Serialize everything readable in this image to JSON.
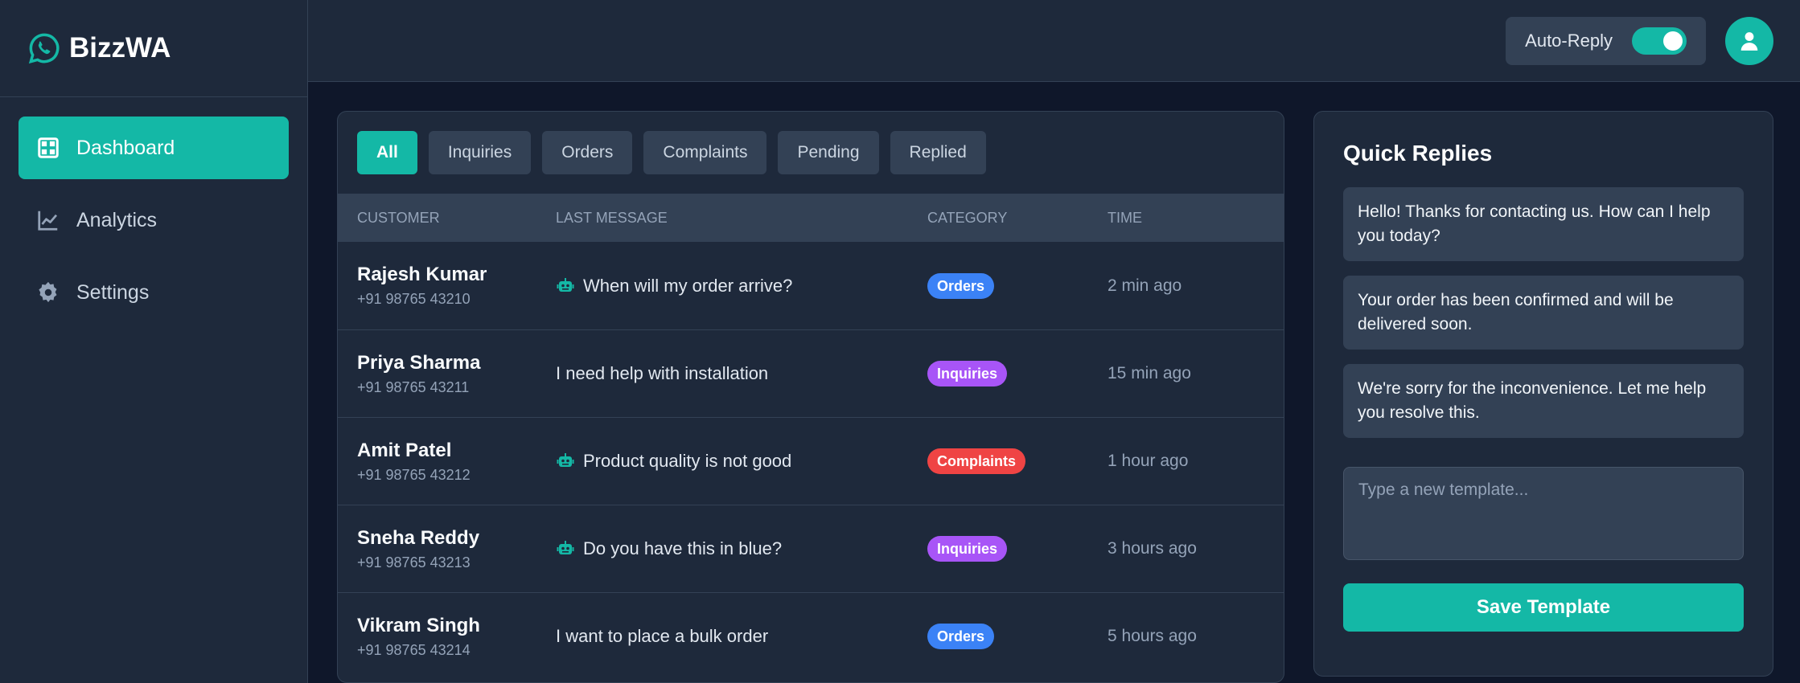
{
  "brand": {
    "name": "BizzWA"
  },
  "colors": {
    "accent": "#14b8a6",
    "orders": "#3b82f6",
    "inquiries": "#a855f7",
    "complaints": "#ef4444"
  },
  "sidebar": {
    "items": [
      {
        "label": "Dashboard",
        "icon": "dashboard-icon",
        "active": true
      },
      {
        "label": "Analytics",
        "icon": "chart-line-icon",
        "active": false
      },
      {
        "label": "Settings",
        "icon": "gear-icon",
        "active": false
      }
    ]
  },
  "topbar": {
    "auto_reply_label": "Auto-Reply",
    "auto_reply_on": true
  },
  "filters": [
    "All",
    "Inquiries",
    "Orders",
    "Complaints",
    "Pending",
    "Replied"
  ],
  "table": {
    "headers": [
      "CUSTOMER",
      "LAST MESSAGE",
      "CATEGORY",
      "TIME"
    ],
    "rows": [
      {
        "name": "Rajesh Kumar",
        "phone": "+91 98765 43210",
        "message": "When will my order arrive?",
        "bot": true,
        "category": "Orders",
        "time": "2 min ago"
      },
      {
        "name": "Priya Sharma",
        "phone": "+91 98765 43211",
        "message": "I need help with installation",
        "bot": false,
        "category": "Inquiries",
        "time": "15 min ago"
      },
      {
        "name": "Amit Patel",
        "phone": "+91 98765 43212",
        "message": "Product quality is not good",
        "bot": true,
        "category": "Complaints",
        "time": "1 hour ago"
      },
      {
        "name": "Sneha Reddy",
        "phone": "+91 98765 43213",
        "message": "Do you have this in blue?",
        "bot": true,
        "category": "Inquiries",
        "time": "3 hours ago"
      },
      {
        "name": "Vikram Singh",
        "phone": "+91 98765 43214",
        "message": "I want to place a bulk order",
        "bot": false,
        "category": "Orders",
        "time": "5 hours ago"
      }
    ]
  },
  "quick_replies": {
    "title": "Quick Replies",
    "items": [
      "Hello! Thanks for contacting us. How can I help you today?",
      "Your order has been confirmed and will be delivered soon.",
      "We're sorry for the inconvenience. Let me help you resolve this."
    ],
    "input_placeholder": "Type a new template...",
    "save_label": "Save Template"
  }
}
